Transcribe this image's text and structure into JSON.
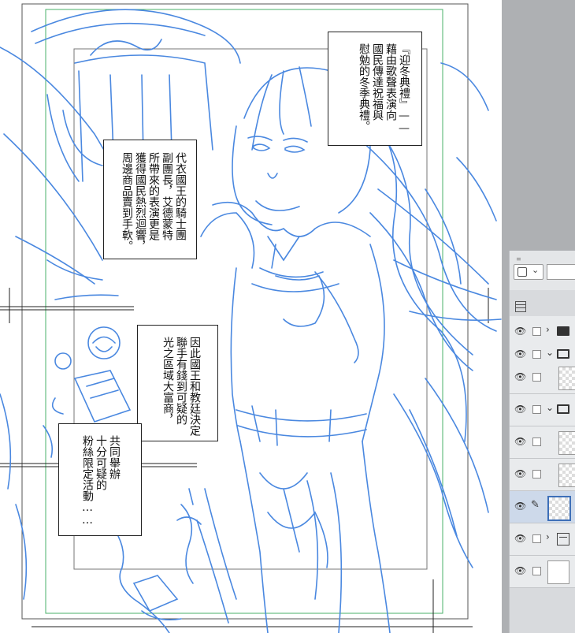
{
  "canvas": {
    "line_color": "#4a88e0",
    "guide_color": "#49b26a"
  },
  "bubbles": {
    "b1": "『迎冬典禮』——\n藉由歌聲表演向\n國民傳達祝福與\n慰勉的冬季典禮。",
    "b2": "代衣國王的騎士團\n副團長，艾德蒙特\n所帶來的表演更是\n獲得國民熱烈迴響，\n周邊商品賣到手軟。",
    "b3": "因此國王和教廷決定\n聯手有錢到可疑的\n光之區域大富商，",
    "b4": "共同舉辦\n十分可疑的\n粉絲限定活動……"
  },
  "layer_panel": {
    "colors": {
      "panel": "#d8dadd",
      "selected": "#cdd9ea"
    },
    "layers": [
      {
        "type": "folder",
        "open": false,
        "selected": false
      },
      {
        "type": "folder",
        "open": true,
        "selected": false
      },
      {
        "type": "raster",
        "selected": false
      },
      {
        "type": "folder",
        "open": true,
        "selected": false
      },
      {
        "type": "raster",
        "selected": false
      },
      {
        "type": "raster",
        "selected": false
      },
      {
        "type": "raster",
        "selected": true,
        "editing": true
      },
      {
        "type": "template",
        "selected": false
      },
      {
        "type": "paper",
        "selected": false
      }
    ]
  }
}
